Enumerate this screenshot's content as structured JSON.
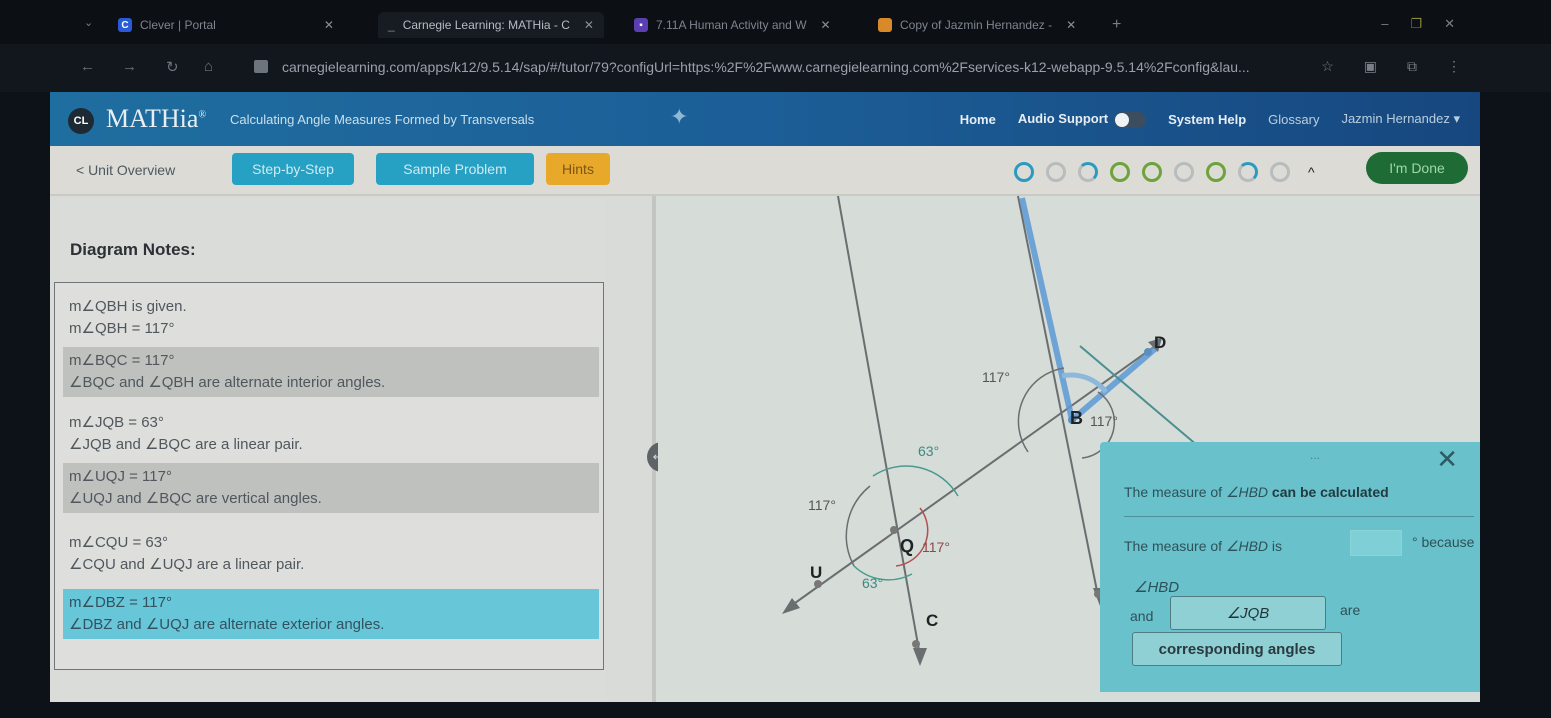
{
  "browser": {
    "tabs": [
      {
        "title": "Clever | Portal",
        "icon": "clever-icon",
        "active": false
      },
      {
        "title": "Carnegie Learning: MATHia - C",
        "icon": "loading-icon",
        "active": true
      },
      {
        "title": "7.11A Human Activity and W",
        "icon": "classroom-icon",
        "active": false
      },
      {
        "title": "Copy of Jazmin Hernandez - ",
        "icon": "slides-icon",
        "active": false
      }
    ],
    "url": "carnegielearning.com/apps/k12/9.5.14/sap/#/tutor/79?configUrl=https:%2F%2Fwww.carnegielearning.com%2Fservices-k12-webapp-9.5.14%2Fconfig&lau..."
  },
  "header": {
    "logo_badge": "CL",
    "logo": "MATHia",
    "logo_mark": "®",
    "lesson_title": "Calculating Angle Measures Formed by Transversals",
    "nav": {
      "home": "Home",
      "audio": "Audio Support",
      "help": "System Help",
      "glossary": "Glossary",
      "user": "Jazmin Hernandez"
    }
  },
  "toolbar": {
    "unit_overview": "< Unit Overview",
    "step_by_step": "Step-by-Step",
    "sample_problem": "Sample Problem",
    "hints": "Hints",
    "progress": [
      "blue",
      "grey",
      "partial-blue",
      "green",
      "green",
      "grey",
      "green",
      "partial-blue",
      "grey"
    ],
    "done": "I'm Done"
  },
  "notes": {
    "title": "Diagram Notes:",
    "items": [
      {
        "line1": "m∠QBH is given.",
        "line2": "m∠QBH = 117°",
        "style": "plain"
      },
      {
        "line1": "m∠BQC = 117°",
        "line2": "∠BQC and ∠QBH are alternate interior angles.",
        "style": "grey"
      },
      {
        "line1": "m∠JQB = 63°",
        "line2": "∠JQB and ∠BQC are a linear pair.",
        "style": "plain"
      },
      {
        "line1": "m∠UQJ = 117°",
        "line2": "∠UQJ and ∠BQC are vertical angles.",
        "style": "grey"
      },
      {
        "line1": "m∠CQU = 63°",
        "line2": "∠CQU and ∠UQJ are a linear pair.",
        "style": "plain"
      },
      {
        "line1": "m∠DBZ = 117°",
        "line2": "∠DBZ and ∠UQJ are alternate exterior angles.",
        "style": "blue"
      }
    ]
  },
  "diagram": {
    "points": {
      "B": "B",
      "D": "D",
      "Q": "Q",
      "U": "U",
      "C": "C"
    },
    "angles": {
      "b_upper_left": "117°",
      "b_lower_right": "117°",
      "q_upper": "63°",
      "q_left": "117°",
      "q_right": "117°",
      "q_lower": "63°"
    }
  },
  "dialog": {
    "dots": "...",
    "line1_prefix": "The measure of ",
    "line1_angle": "∠HBD",
    "line1_suffix": " can be calculated",
    "line2_prefix": "The measure of ",
    "line2_angle": "∠HBD",
    "line2_is": " is",
    "answer_value": "",
    "because": "° because",
    "angle_hbd": "∠HBD",
    "and": "and",
    "select_angle": "∠JQB",
    "are": "are",
    "select_relation": "corresponding angles"
  }
}
